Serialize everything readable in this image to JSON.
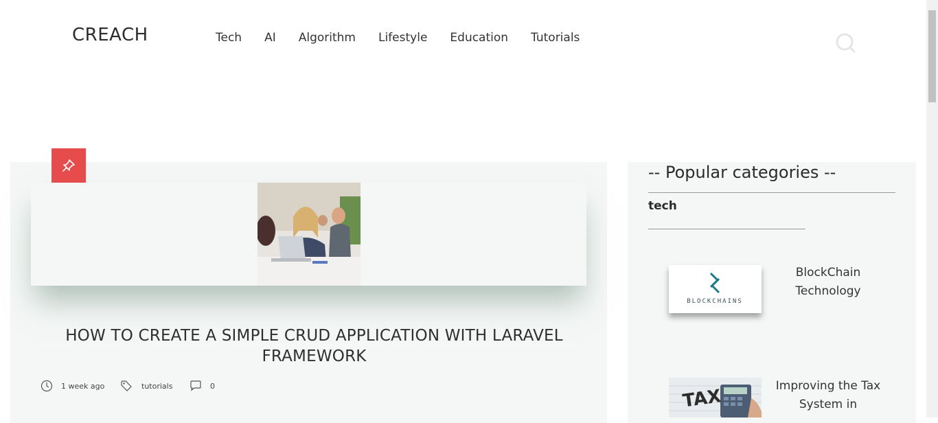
{
  "header": {
    "logo": "CREACH",
    "nav": [
      "Tech",
      "AI",
      "Algorithm",
      "Lifestyle",
      "Education",
      "Tutorials"
    ],
    "search_icon": "search-icon"
  },
  "post": {
    "badge_icon": "pin-icon",
    "badge_color": "#e74c4c",
    "title": "HOW TO CREATE A SIMPLE CRUD APPLICATION WITH LARAVEL FRAMEWORK",
    "time": "1 week ago",
    "tag": "tutorials",
    "comments": "0"
  },
  "sidebar": {
    "heading": "-- Popular categories --",
    "category": "tech",
    "items": [
      {
        "title": "BlockChain Technology",
        "thumb_text": "BLOCKCHAINS"
      },
      {
        "title": "Improving the Tax System in",
        "thumb_text": "TAX"
      }
    ]
  }
}
